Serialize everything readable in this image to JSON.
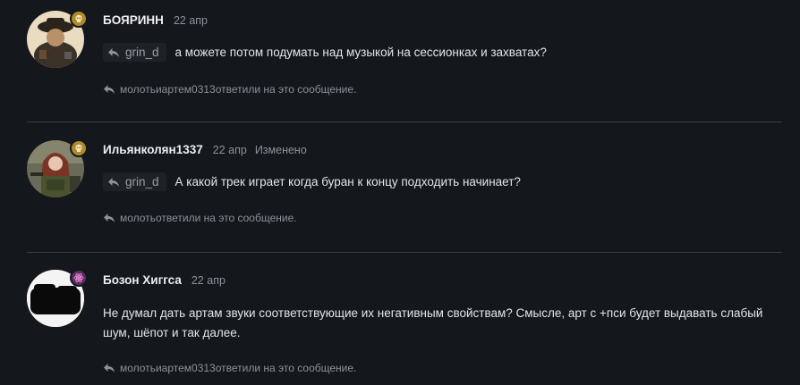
{
  "comments": [
    {
      "username": "БОЯРИНН",
      "date": "22 апр",
      "quote_user": "grin_d",
      "text": "а можете потом подумать над музыкой на сессионках и захватах?",
      "replies_users": "молотьиартем0313",
      "replies_suffix": "ответили на это сообщение.",
      "badge_icon": "skull-icon",
      "badge_color": "#b08a2a"
    },
    {
      "username": "Ильянколян1337",
      "date": "22 апр",
      "edited": "Изменено",
      "quote_user": "grin_d",
      "text": "А какой трек играет когда буран к концу подходить начинает?",
      "replies_users": "молоть",
      "replies_suffix": "ответили на это сообщение.",
      "badge_icon": "skull-icon",
      "badge_color": "#b08a2a"
    },
    {
      "username": "Бозон Хиггса",
      "date": "22 апр",
      "text": "Не думал дать артам звуки соответствующие их негативным свойствам? Смысле, арт с +пси будет выдавать слабый шум, шёпот и так далее.",
      "replies_users": "молотьиартем0313",
      "replies_suffix": "ответили на это сообщение.",
      "badge_icon": "atom-icon",
      "badge_color": "#5b2a6a"
    }
  ],
  "colors": {
    "background": "#14171c",
    "divider": "#3a3e45",
    "username": "#eceef1",
    "muted": "#8d9199",
    "quote_chip_bg": "#1e2227"
  }
}
